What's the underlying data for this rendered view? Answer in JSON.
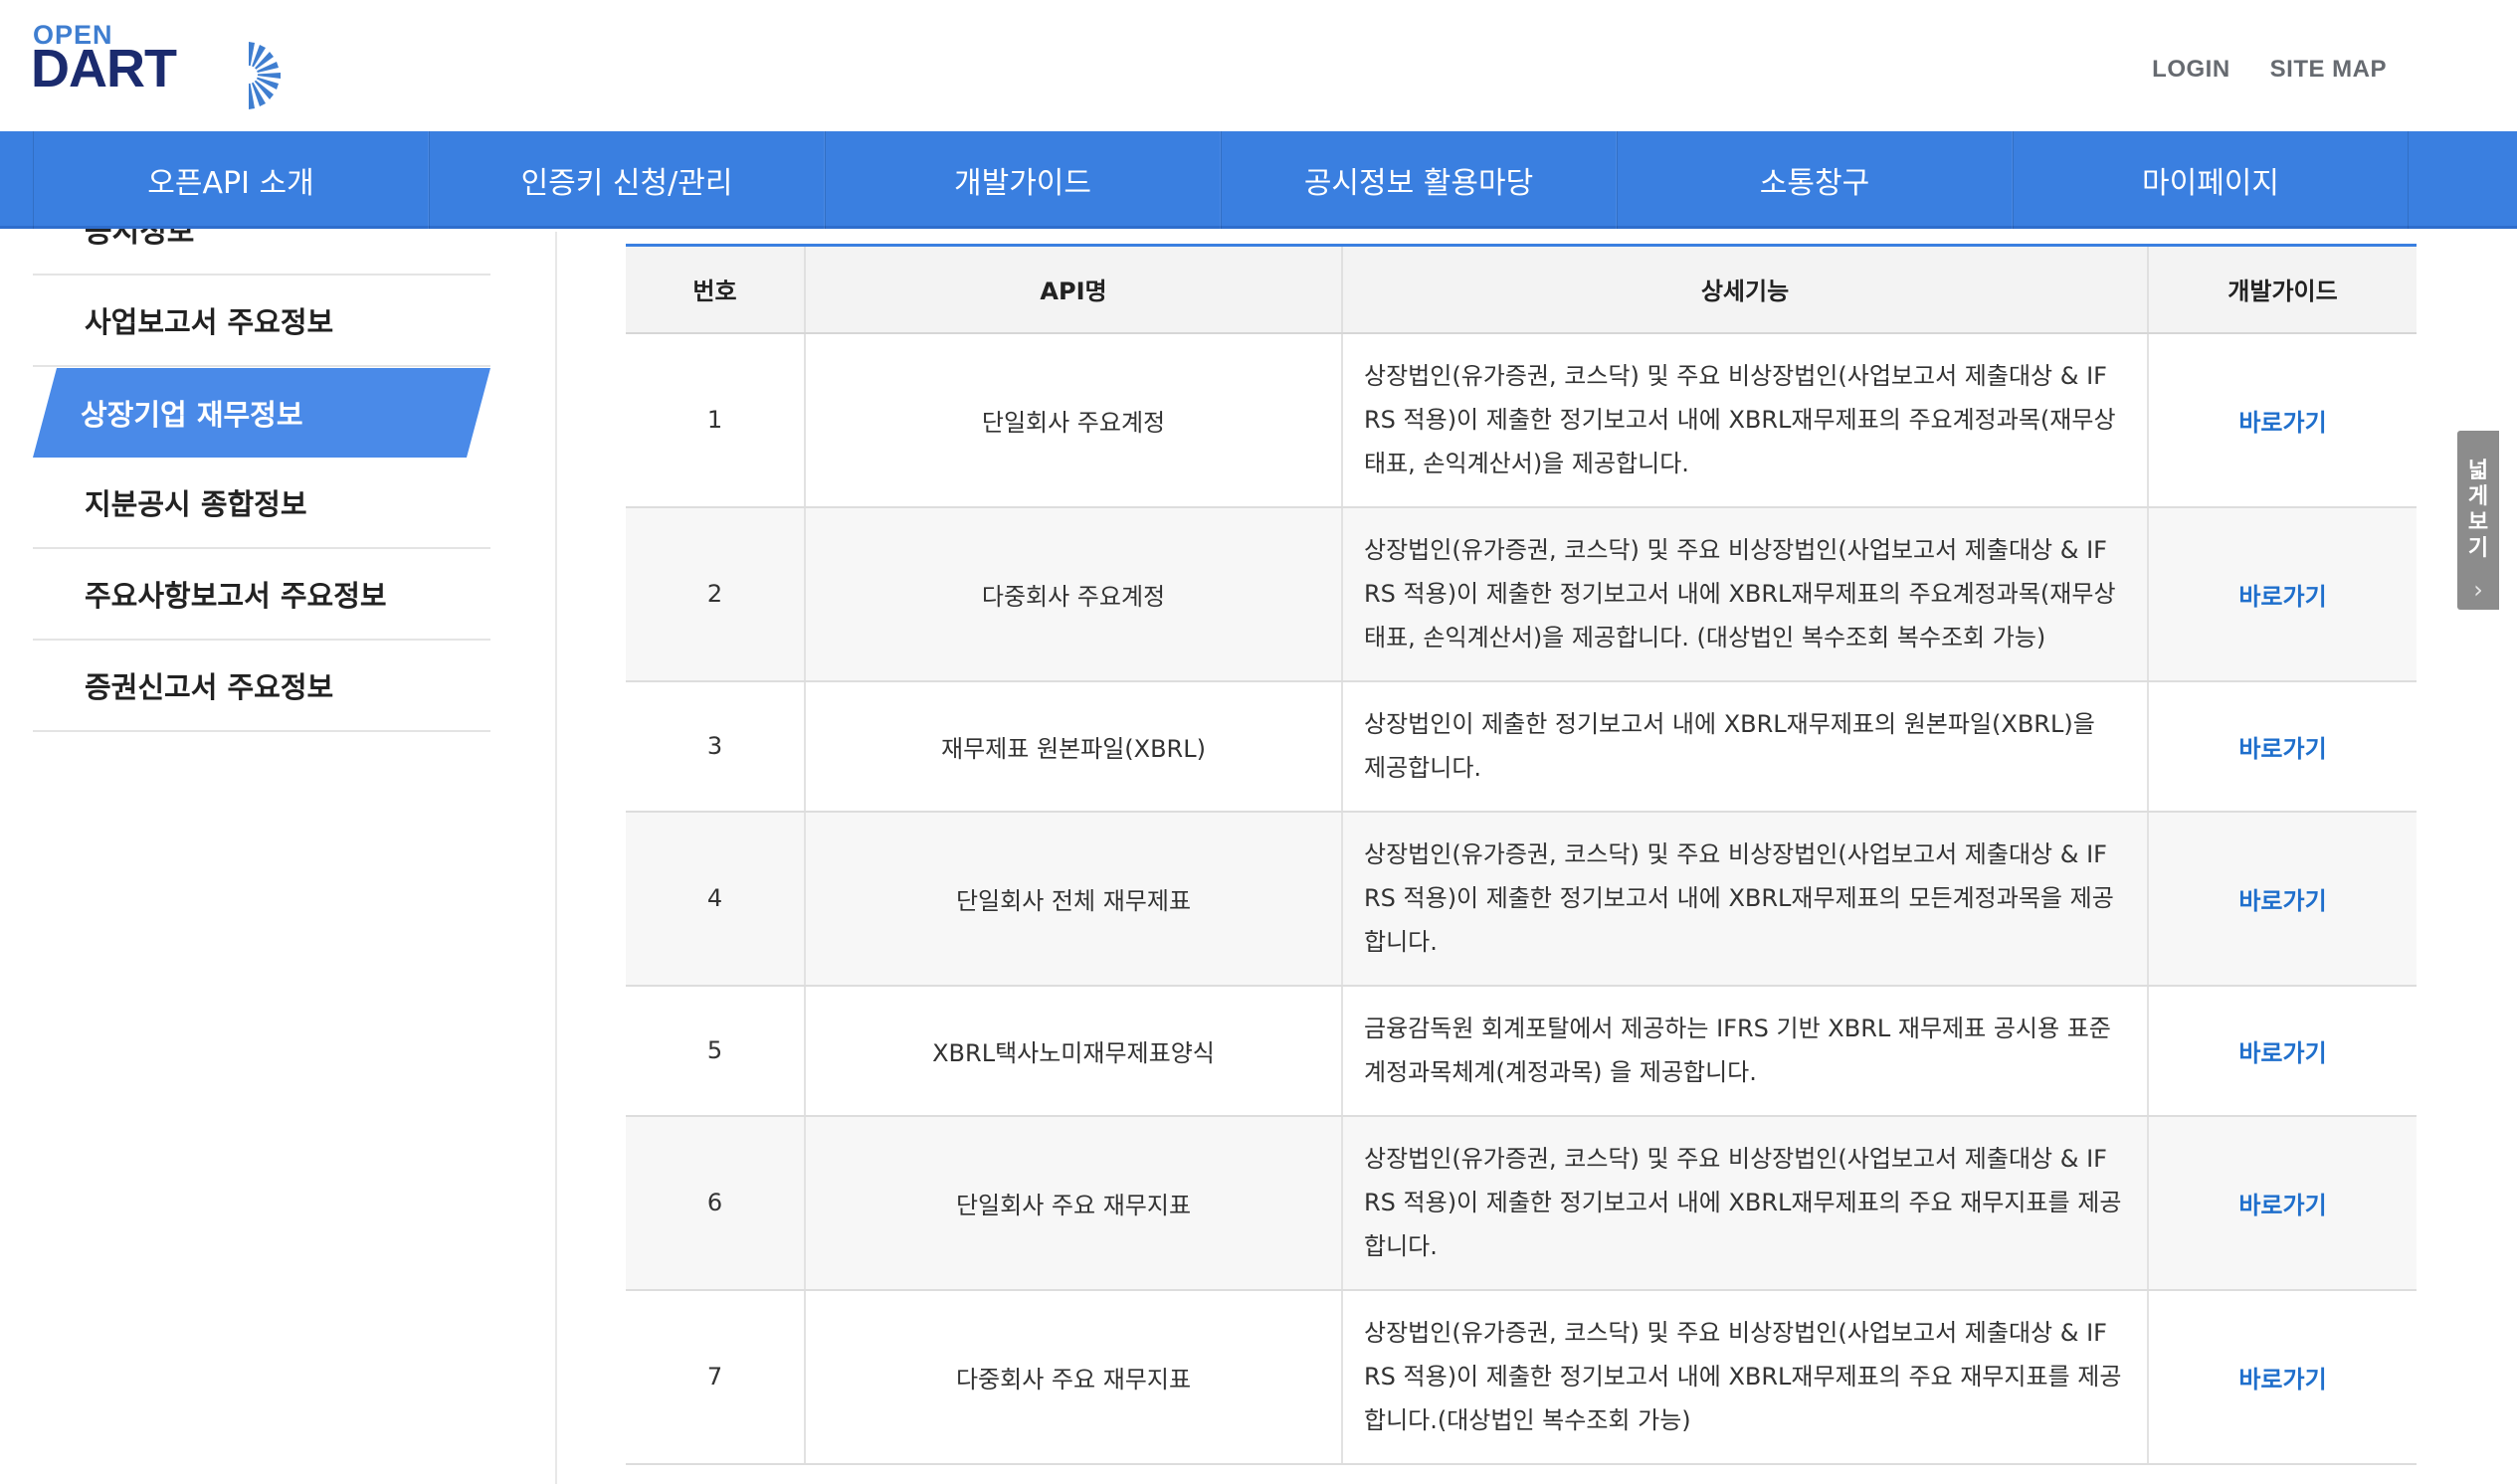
{
  "header": {
    "logo_open": "OPEN",
    "logo_dart": "DART",
    "links": [
      {
        "label": "LOGIN"
      },
      {
        "label": "SITE MAP"
      }
    ]
  },
  "gnb": [
    {
      "label": "오픈API 소개"
    },
    {
      "label": "인증키 신청/관리"
    },
    {
      "label": "개발가이드"
    },
    {
      "label": "공시정보 활용마당"
    },
    {
      "label": "소통창구"
    },
    {
      "label": "마이페이지"
    }
  ],
  "sidebar": {
    "partial_label": "공시정보",
    "items": [
      {
        "label": "사업보고서 주요정보"
      },
      {
        "label": "상장기업 재무정보",
        "active": true
      },
      {
        "label": "지분공시 종합정보"
      },
      {
        "label": "주요사항보고서 주요정보"
      },
      {
        "label": "증권신고서 주요정보"
      }
    ]
  },
  "table": {
    "headers": [
      "번호",
      "API명",
      "상세기능",
      "개발가이드"
    ],
    "rows": [
      {
        "no": "1",
        "name": "단일회사 주요계정",
        "desc": "상장법인(유가증권, 코스닥) 및 주요 비상장법인(사업보고서 제출대상 & IFRS 적용)이 제출한 정기보고서 내에 XBRL재무제표의 주요계정과목(재무상태표, 손익계산서)을 제공합니다.",
        "link": "바로가기"
      },
      {
        "no": "2",
        "name": "다중회사 주요계정",
        "desc": "상장법인(유가증권, 코스닥) 및 주요 비상장법인(사업보고서 제출대상 & IFRS 적용)이 제출한 정기보고서 내에 XBRL재무제표의 주요계정과목(재무상태표, 손익계산서)을 제공합니다. (대상법인 복수조회 복수조회 가능)",
        "link": "바로가기"
      },
      {
        "no": "3",
        "name": "재무제표 원본파일(XBRL)",
        "desc": "상장법인이 제출한 정기보고서 내에 XBRL재무제표의 원본파일(XBRL)을 제공합니다.",
        "link": "바로가기"
      },
      {
        "no": "4",
        "name": "단일회사 전체 재무제표",
        "desc": "상장법인(유가증권, 코스닥) 및 주요 비상장법인(사업보고서 제출대상 & IFRS 적용)이 제출한 정기보고서 내에 XBRL재무제표의 모든계정과목을 제공합니다.",
        "link": "바로가기"
      },
      {
        "no": "5",
        "name": "XBRL택사노미재무제표양식",
        "desc": "금융감독원 회계포탈에서 제공하는 IFRS 기반 XBRL 재무제표 공시용 표준계정과목체계(계정과목) 을 제공합니다.",
        "link": "바로가기"
      },
      {
        "no": "6",
        "name": "단일회사 주요 재무지표",
        "desc": "상장법인(유가증권, 코스닥) 및 주요 비상장법인(사업보고서 제출대상 & IFRS 적용)이 제출한 정기보고서 내에 XBRL재무제표의 주요 재무지표를 제공합니다.",
        "link": "바로가기"
      },
      {
        "no": "7",
        "name": "다중회사 주요 재무지표",
        "desc": "상장법인(유가증권, 코스닥) 및 주요 비상장법인(사업보고서 제출대상 & IFRS 적용)이 제출한 정기보고서 내에 XBRL재무제표의 주요 재무지표를 제공합니다.(대상법인 복수조회 가능)",
        "link": "바로가기"
      }
    ]
  },
  "wide_view": {
    "chars": [
      "넓",
      "게",
      "보",
      "기"
    ],
    "arrow": "›"
  },
  "colors": {
    "accent": "#3a7fe0",
    "link": "#1f6fcc",
    "logo_navy": "#1b2b6e"
  }
}
